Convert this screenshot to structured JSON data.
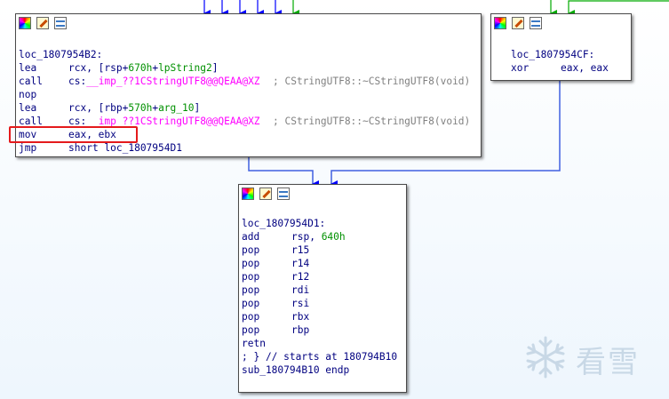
{
  "colors": {
    "edge_blue": "#0000ff",
    "edge_green": "#00aa00",
    "edge_outline_blue": "#4060e0",
    "highlight_red": "#e41a1c",
    "operand_green": "#009000",
    "import_pink": "#ff00ff",
    "comment_gray": "#808080"
  },
  "header_icons": [
    "palette-icon",
    "pencil-icon",
    "graph-icon"
  ],
  "block_left": {
    "label": "loc_1807954B2:",
    "lines": [
      {
        "mn": "lea",
        "op_a": "rcx, [rsp+",
        "op_b": "670h",
        "op_c": "+",
        "op_d": "lpString2",
        "op_e": "]"
      },
      {
        "mn": "call",
        "op_a": "cs:",
        "op_b": "__imp_??1CStringUTF8@@QEAA@XZ",
        "comment": "; CStringUTF8::~CStringUTF8(void)"
      },
      {
        "mn": "nop"
      },
      {
        "mn": "lea",
        "op_a": "rcx, [rbp+",
        "op_b": "570h",
        "op_c": "+",
        "op_d": "arg_10",
        "op_e": "]"
      },
      {
        "mn": "call",
        "op_a": "cs:",
        "op_b": "__imp_??1CStringUTF8@@QEAA@XZ",
        "comment": "; CStringUTF8::~CStringUTF8(void)"
      },
      {
        "mn": "mov",
        "op_a": "eax, ebx"
      },
      {
        "mn": "jmp",
        "op_a": "short loc_1807954D1"
      }
    ]
  },
  "block_right": {
    "label": "loc_1807954CF:",
    "lines": [
      {
        "mn": "xor",
        "op_a": "eax, eax"
      }
    ]
  },
  "block_bottom": {
    "label": "loc_1807954D1:",
    "lines": [
      {
        "mn": "add",
        "op_a": "rsp, ",
        "op_b": "640h"
      },
      {
        "mn": "pop",
        "op_a": "r15"
      },
      {
        "mn": "pop",
        "op_a": "r14"
      },
      {
        "mn": "pop",
        "op_a": "r12"
      },
      {
        "mn": "pop",
        "op_a": "rdi"
      },
      {
        "mn": "pop",
        "op_a": "rsi"
      },
      {
        "mn": "pop",
        "op_a": "rbx"
      },
      {
        "mn": "pop",
        "op_a": "rbp"
      },
      {
        "mn": "retn"
      },
      {
        "mn": "; } // starts at 180794B10"
      },
      {
        "mn": "sub_180794B10 endp"
      }
    ]
  },
  "watermark": {
    "text": "看雪"
  }
}
